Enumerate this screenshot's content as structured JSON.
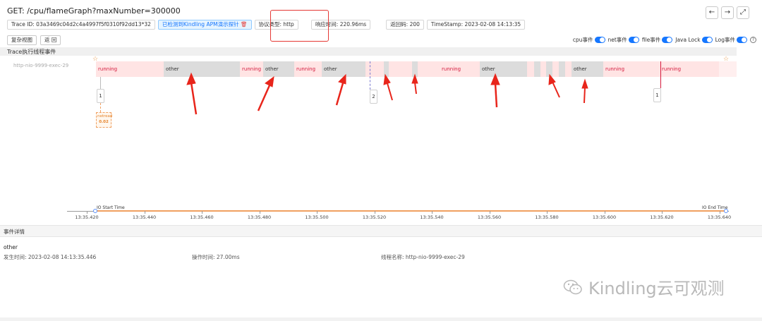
{
  "title": "GET: /cpu/flameGraph?maxNumber=300000",
  "meta": {
    "trace_id": "Trace ID: 03a3469c04d2c4a4997f5f0310f92dd13*32",
    "apm_tag": "已检测到Kindling APM演示探针",
    "protocol": "协议类型: http",
    "response_time": "响应时间: 220.96ms",
    "return_code": "返回码: 200",
    "timestamp": "TimeStamp: 2023-02-08 14:13:35"
  },
  "buttons": {
    "restore": "复杂视图",
    "back": "返 回"
  },
  "toggles": [
    "cpu事件",
    "net事件",
    "file事件",
    "Java Lock",
    "Log事件"
  ],
  "section_title": "Trace执行线程事件",
  "thread_label": "http-nio-9999-exec-29",
  "event_labels": {
    "running": "running",
    "other": "other"
  },
  "badges": [
    "1",
    "2",
    "1"
  ],
  "io_card": {
    "line1": "netread",
    "line2": "0.02"
  },
  "axis": {
    "io_start": "IO Start Time",
    "io_end": "IO End Time",
    "ticks": [
      "13:35.420",
      "13:35.440",
      "13:35.460",
      "13:35.480",
      "13:35.500",
      "13:35.520",
      "13:35.540",
      "13:35.560",
      "13:35.580",
      "13:35.600",
      "13:35.620",
      "13:35.640"
    ]
  },
  "details": {
    "section": "事件详情",
    "name": "other",
    "occur_time": "发生时间:  2023-02-08 14:13:35.446",
    "duration": "操作时间:  27.00ms",
    "thread": "线程名称:  http-nio-9999-exec-29"
  },
  "watermark": "Kindling云可观测",
  "colors": {
    "running_bg": "#ffe4e4",
    "running_text": "#d4183b",
    "other_bg": "#dcdcdc",
    "accent": "#1677ff",
    "annotation": "#e53935"
  }
}
